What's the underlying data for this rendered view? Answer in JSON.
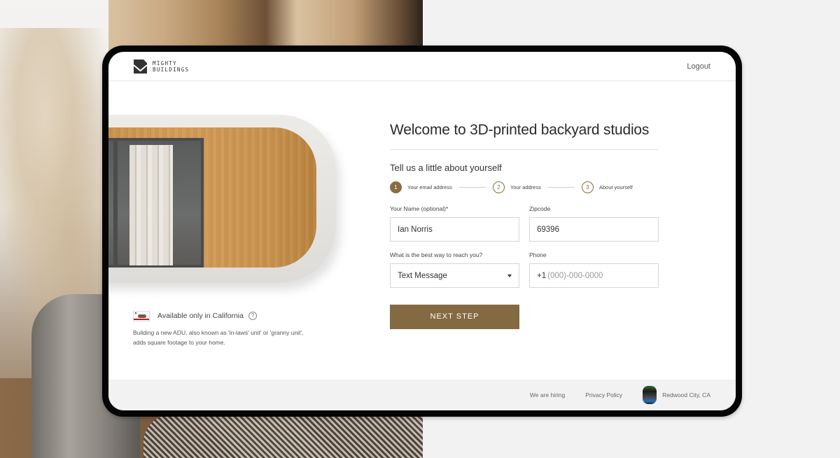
{
  "brand": {
    "name_line1": "MIGHTY",
    "name_line2": "BUILDINGS",
    "logo_icon": "envelope-shield-logo"
  },
  "header": {
    "logout_label": "Logout"
  },
  "availability": {
    "flag_icon": "california-flag-icon",
    "title": "Available only in California",
    "help_icon_glyph": "?",
    "description": "Building a new ADU, also known as 'in-laws' unit' or 'granny unit', adds square footage to your home."
  },
  "form": {
    "title": "Welcome to 3D-printed backyard studios",
    "subtitle": "Tell us a little about yourself",
    "steps": [
      {
        "number": "1",
        "label": "Your email address",
        "active": true
      },
      {
        "number": "2",
        "label": "Your address",
        "active": false
      },
      {
        "number": "3",
        "label": "About yourself",
        "active": false
      }
    ],
    "fields": {
      "name": {
        "label": "Your Name (optional)*",
        "value": "Ian Norris"
      },
      "zipcode": {
        "label": "Zipcode",
        "value": "69396"
      },
      "contact_method": {
        "label": "What is the best way to reach you?",
        "value": "Text Message"
      },
      "phone": {
        "label": "Phone",
        "prefix": "+1",
        "placeholder": "(000)-000-0000",
        "value": ""
      }
    },
    "next_button_label": "NEXT STEP"
  },
  "footer": {
    "hiring_label": "We are hiring",
    "privacy_label": "Privacy Policy",
    "city_badge_icon": "redwood-city-badge-icon",
    "location_label": "Redwood City, CA"
  },
  "colors": {
    "accent": "#846a42",
    "footer_bg": "#f2f2f2",
    "frame": "#050505"
  }
}
